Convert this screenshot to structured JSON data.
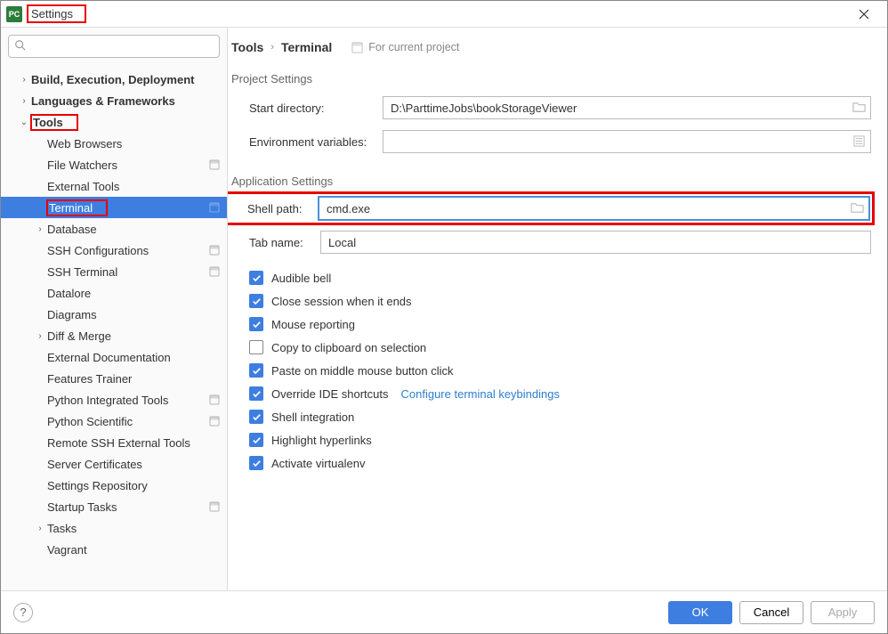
{
  "window": {
    "title": "Settings",
    "app_icon_text": "PC"
  },
  "search": {
    "placeholder": ""
  },
  "tree": {
    "items": [
      {
        "label": "Build, Execution, Deployment",
        "level": 0,
        "arrow": "›",
        "bold": true
      },
      {
        "label": "Languages & Frameworks",
        "level": 0,
        "arrow": "›",
        "bold": true
      },
      {
        "label": "Tools",
        "level": 0,
        "arrow": "⌄",
        "bold": true,
        "highlight": true
      },
      {
        "label": "Web Browsers",
        "level": 1
      },
      {
        "label": "File Watchers",
        "level": 1,
        "badge": true
      },
      {
        "label": "External Tools",
        "level": 1
      },
      {
        "label": "Terminal",
        "level": 1,
        "selected": true,
        "badge": true,
        "highlight": true
      },
      {
        "label": "Database",
        "level": 1,
        "arrow": "›"
      },
      {
        "label": "SSH Configurations",
        "level": 1,
        "badge": true
      },
      {
        "label": "SSH Terminal",
        "level": 1,
        "badge": true
      },
      {
        "label": "Datalore",
        "level": 1
      },
      {
        "label": "Diagrams",
        "level": 1
      },
      {
        "label": "Diff & Merge",
        "level": 1,
        "arrow": "›"
      },
      {
        "label": "External Documentation",
        "level": 1
      },
      {
        "label": "Features Trainer",
        "level": 1
      },
      {
        "label": "Python Integrated Tools",
        "level": 1,
        "badge": true
      },
      {
        "label": "Python Scientific",
        "level": 1,
        "badge": true
      },
      {
        "label": "Remote SSH External Tools",
        "level": 1
      },
      {
        "label": "Server Certificates",
        "level": 1
      },
      {
        "label": "Settings Repository",
        "level": 1
      },
      {
        "label": "Startup Tasks",
        "level": 1,
        "badge": true
      },
      {
        "label": "Tasks",
        "level": 1,
        "arrow": "›"
      },
      {
        "label": "Vagrant",
        "level": 1
      }
    ]
  },
  "breadcrumb": {
    "root": "Tools",
    "leaf": "Terminal",
    "scope": "For current project"
  },
  "project_settings": {
    "title": "Project Settings",
    "start_dir_label": "Start directory:",
    "start_dir_value": "D:\\ParttimeJobs\\bookStorageViewer",
    "env_label": "Environment variables:",
    "env_value": ""
  },
  "app_settings": {
    "title": "Application Settings",
    "shell_label": "Shell path:",
    "shell_value": "cmd.exe",
    "tab_label": "Tab name:",
    "tab_value": "Local",
    "checks": [
      {
        "label": "Audible bell",
        "checked": true
      },
      {
        "label": "Close session when it ends",
        "checked": true
      },
      {
        "label": "Mouse reporting",
        "checked": true
      },
      {
        "label": "Copy to clipboard on selection",
        "checked": false
      },
      {
        "label": "Paste on middle mouse button click",
        "checked": true
      },
      {
        "label": "Override IDE shortcuts",
        "checked": true,
        "link": "Configure terminal keybindings"
      },
      {
        "label": "Shell integration",
        "checked": true
      },
      {
        "label": "Highlight hyperlinks",
        "checked": true
      },
      {
        "label": "Activate virtualenv",
        "checked": true
      }
    ]
  },
  "footer": {
    "ok": "OK",
    "cancel": "Cancel",
    "apply": "Apply",
    "help": "?"
  }
}
